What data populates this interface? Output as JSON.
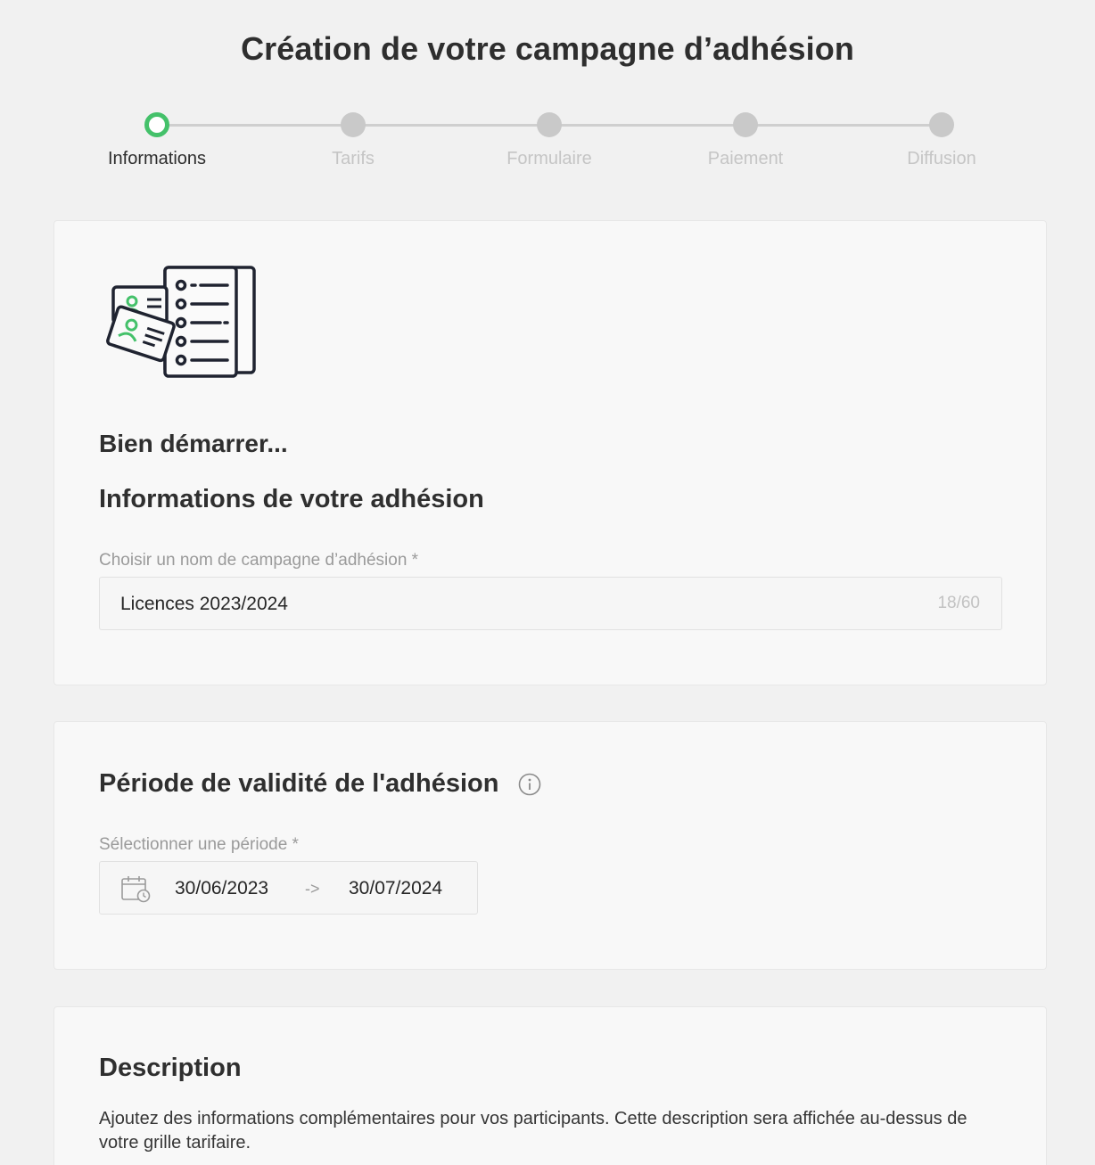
{
  "page_title": "Création de votre campagne d’adhésion",
  "stepper": {
    "steps": [
      {
        "label": "Informations",
        "active": true
      },
      {
        "label": "Tarifs",
        "active": false
      },
      {
        "label": "Formulaire",
        "active": false
      },
      {
        "label": "Paiement",
        "active": false
      },
      {
        "label": "Diffusion",
        "active": false
      }
    ]
  },
  "colors": {
    "accent": "#44c16a",
    "inactive_step": "#c9c9c9"
  },
  "info_card": {
    "illustration_icon": "membership-cards-list-icon",
    "subtitle": "Bien démarrer...",
    "section_title": "Informations de votre adhésion",
    "name_field": {
      "label": "Choisir un nom de campagne d’adhésion *",
      "value": "Licences 2023/2024",
      "counter": "18/60"
    }
  },
  "validity_card": {
    "section_title": "Période de validité de l'adhésion",
    "info_icon": "info-icon",
    "period_field": {
      "label": "Sélectionner une période *",
      "calendar_icon": "calendar-clock-icon",
      "start": "30/06/2023",
      "arrow": "->",
      "end": "30/07/2024"
    }
  },
  "description_card": {
    "section_title": "Description",
    "text": "Ajoutez des informations complémentaires pour vos participants. Cette description sera affichée au-dessus de votre grille tarifaire."
  }
}
